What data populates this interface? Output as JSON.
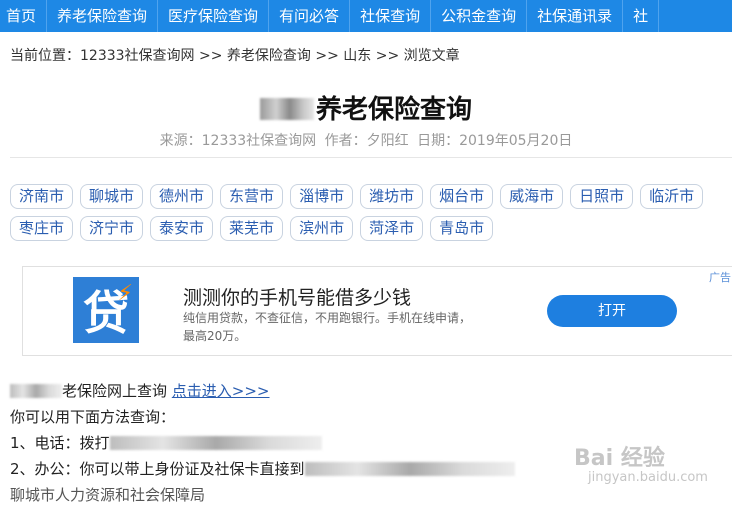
{
  "nav": {
    "items": [
      "首页",
      "养老保险查询",
      "医疗保险查询",
      "有问必答",
      "社保查询",
      "公积金查询",
      "社保通讯录",
      "社"
    ]
  },
  "breadcrumb": "当前位置：12333社保查询网 >> 养老保险查询 >> 山东 >> 浏览文章",
  "article": {
    "title": "养老保险查询",
    "source": "来源：12333社保查询网",
    "author": "作者：夕阳红",
    "date": "日期：2019年05月20日"
  },
  "cities": [
    "济南市",
    "聊城市",
    "德州市",
    "东营市",
    "淄博市",
    "潍坊市",
    "烟台市",
    "威海市",
    "日照市",
    "临沂市",
    "枣庄市",
    "济宁市",
    "泰安市",
    "莱芜市",
    "滨州市",
    "菏泽市",
    "青岛市"
  ],
  "ad": {
    "logo_char": "贷",
    "title": "测测你的手机号能借多少钱",
    "desc": "纯信用贷款，不查征信，不用跑银行。手机在线申请，最高20万。",
    "button": "打开",
    "tag": "广告"
  },
  "body": {
    "line1_suffix": "老保险网上查询",
    "line1_link": "点击进入>>>",
    "line2": "你可以用下面方法查询：",
    "line3_prefix": "1、电话：拨打",
    "line4_prefix": "2、办公：你可以带上身份证及社保卡直接到",
    "line5": "聊城市人力资源和社会保障局"
  },
  "watermark": {
    "text": "Bai 经验",
    "sub": "jingyan.baidu.com"
  }
}
